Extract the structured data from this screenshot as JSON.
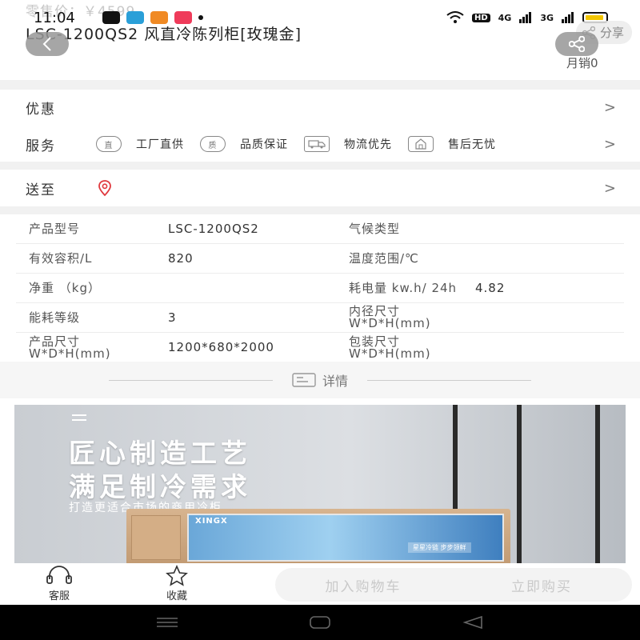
{
  "faded_price": "零售价：￥4599",
  "status_bar": {
    "time": "11:04",
    "app_icons": [
      "tiktok-icon",
      "telegram-icon",
      "weibo-icon",
      "video-icon"
    ],
    "hd_badge": "HD",
    "net1": "4G",
    "net2": "3G"
  },
  "product": {
    "title": "LSC-1200QS2  风直冷陈列柜[玫瑰金]",
    "share_label": "分享",
    "monthly_sales": "月销0"
  },
  "promo": {
    "label": "优惠"
  },
  "service": {
    "label": "服务",
    "items": [
      {
        "icon_text": "直",
        "label": "工厂直供"
      },
      {
        "icon_text": "质",
        "label": "品质保证"
      },
      {
        "icon_text": "",
        "label": "物流优先"
      },
      {
        "icon_text": "",
        "label": "售后无忧"
      }
    ]
  },
  "delivery": {
    "label": "送至"
  },
  "specs": [
    {
      "k1": "产品型号",
      "v1": "LSC-1200QS2",
      "k2": "气候类型",
      "v2": ""
    },
    {
      "k1": "有效容积/L",
      "v1": "820",
      "k2": "温度范围/℃",
      "v2": ""
    },
    {
      "k1": "净重 （kg）",
      "v1": "",
      "k2": "耗电量 kw.h/ 24h",
      "v2": "4.82"
    },
    {
      "k1": "能耗等级",
      "v1": "3",
      "k2": "内径尺寸 W*D*H(mm)",
      "v2": ""
    },
    {
      "k1": "产品尺寸 W*D*H(mm)",
      "v1": "1200*680*2000",
      "k2": "包装尺寸 W*D*H(mm)",
      "v2": ""
    }
  ],
  "detail_label": "详情",
  "banner": {
    "headline1": "匠心制造工艺",
    "headline2": "满足制冷需求",
    "subline": "打造更适合市场的商用冷柜",
    "brand": "XINGX",
    "glass_label": "星星冷链  步步领鲜"
  },
  "bottom_bar": {
    "service_label": "客服",
    "favorite_label": "收藏",
    "add_to_cart": "加入购物车",
    "buy_now": "立即购买"
  },
  "colors": {
    "accent_pin": "#e0393e",
    "band": "#f1f1f1"
  }
}
